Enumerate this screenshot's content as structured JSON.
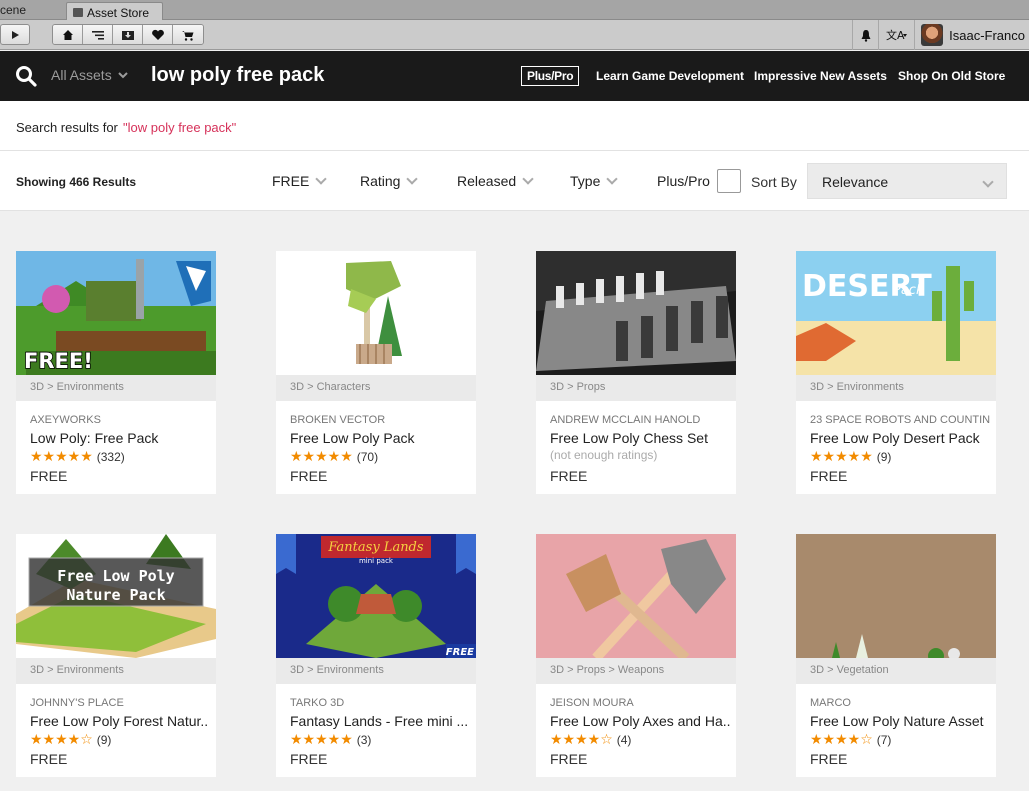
{
  "tabs": {
    "scene_label": "cene",
    "store_label": "Asset Store"
  },
  "user": {
    "name": "Isaac-Franco"
  },
  "header": {
    "category_label": "All Assets",
    "query": "low poly free pack",
    "plus_pro_badge": "Plus/Pro",
    "links": [
      "Learn Game Development",
      "Impressive New Assets",
      "Shop On Old Store"
    ]
  },
  "search": {
    "results_label": "Search results for",
    "term": "\"low poly free pack\""
  },
  "filters": {
    "showing": "Showing 466 Results",
    "items": [
      "FREE",
      "Rating",
      "Released",
      "Type"
    ],
    "plus_pro_label": "Plus/Pro",
    "sort_label": "Sort By",
    "sort_value": "Relevance"
  },
  "cards": [
    {
      "category": "3D > Environments",
      "publisher": "AXEYWORKS",
      "title": "Low Poly: Free Pack",
      "stars": "★★★★★",
      "count": "(332)",
      "price": "FREE",
      "badge": "FREE!"
    },
    {
      "category": "3D > Characters",
      "publisher": "BROKEN VECTOR",
      "title": "Free Low Poly Pack",
      "stars": "★★★★★",
      "count": "(70)",
      "price": "FREE"
    },
    {
      "category": "3D > Props",
      "publisher": "ANDREW MCCLAIN HANOLD",
      "title": "Free Low Poly Chess Set",
      "stars": "",
      "count": "(not enough ratings)",
      "price": "FREE"
    },
    {
      "category": "3D > Environments",
      "publisher": "23 SPACE ROBOTS AND COUNTIN..",
      "title": "Free Low Poly Desert Pack",
      "stars": "★★★★★",
      "count": "(9)",
      "price": "FREE",
      "thumb_title": "DESERT",
      "thumb_sub": "Pack"
    },
    {
      "category": "3D > Environments",
      "publisher": "JOHNNY'S PLACE",
      "title": "Free Low Poly Forest Natur..",
      "stars": "★★★★☆",
      "count": "(9)",
      "price": "FREE",
      "thumb_title": "Free Low Poly",
      "thumb_sub": "Nature Pack"
    },
    {
      "category": "3D > Environments",
      "publisher": "TARKO 3D",
      "title": "Fantasy Lands - Free mini ...",
      "stars": "★★★★★",
      "count": "(3)",
      "price": "FREE",
      "thumb_title": "Fantasy Lands",
      "thumb_sub": "mini pack",
      "badge": "FREE"
    },
    {
      "category": "3D > Props > Weapons",
      "publisher": "JEISON MOURA",
      "title": "Free Low Poly Axes and Ha..",
      "stars": "★★★★☆",
      "count": "(4)",
      "price": "FREE"
    },
    {
      "category": "3D > Vegetation",
      "publisher": "MARCO",
      "title": "Free Low Poly Nature Asset",
      "stars": "★★★★☆",
      "count": "(7)",
      "price": "FREE"
    }
  ]
}
